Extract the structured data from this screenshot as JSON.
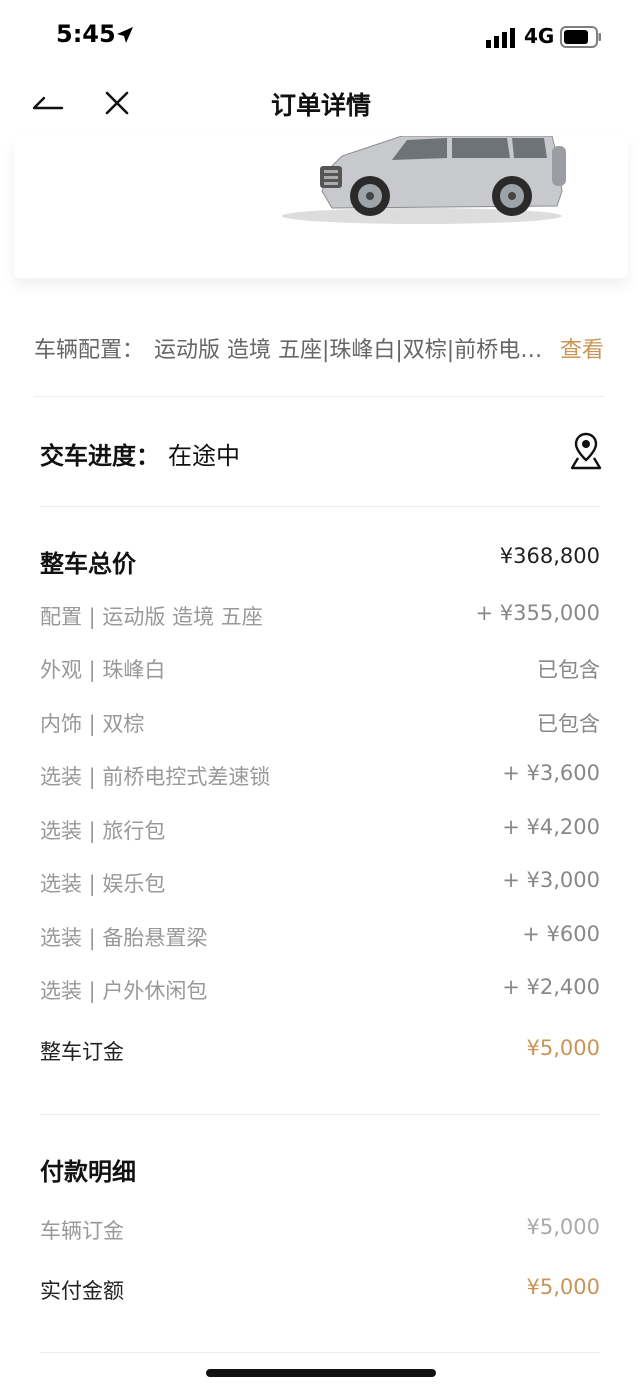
{
  "status_bar": {
    "time": "5:45",
    "network": "4G"
  },
  "nav": {
    "title": "订单详情"
  },
  "config": {
    "label": "车辆配置：",
    "value": "运动版 造境 五座|珠峰白|双棕|前桥电控式差速锁|旅行包|娱乐包|备胎悬置梁|户外休闲包",
    "link": "查看"
  },
  "delivery": {
    "label": "交车进度：",
    "value": "在途中"
  },
  "total": {
    "title": "整车总价",
    "value": "¥368,800",
    "items": [
      {
        "label": "配置 | 运动版 造境 五座",
        "value": "+ ¥355,000"
      },
      {
        "label": "外观 | 珠峰白",
        "value": "已包含"
      },
      {
        "label": "内饰 | 双棕",
        "value": "已包含"
      },
      {
        "label": "选装 | 前桥电控式差速锁",
        "value": "+ ¥3,600"
      },
      {
        "label": "选装 | 旅行包",
        "value": "+ ¥4,200"
      },
      {
        "label": "选装 | 娱乐包",
        "value": "+ ¥3,000"
      },
      {
        "label": "选装 | 备胎悬置梁",
        "value": "+ ¥600"
      },
      {
        "label": "选装 | 户外休闲包",
        "value": "+ ¥2,400"
      }
    ],
    "deposit_label": "整车订金",
    "deposit_value": "¥5,000"
  },
  "payment": {
    "title": "付款明细",
    "items": [
      {
        "label": "车辆订金",
        "value": "¥5,000"
      },
      {
        "label": "实付金额",
        "value": "¥5,000"
      }
    ]
  },
  "colors": {
    "accent": "#c99458",
    "muted": "#999999"
  }
}
